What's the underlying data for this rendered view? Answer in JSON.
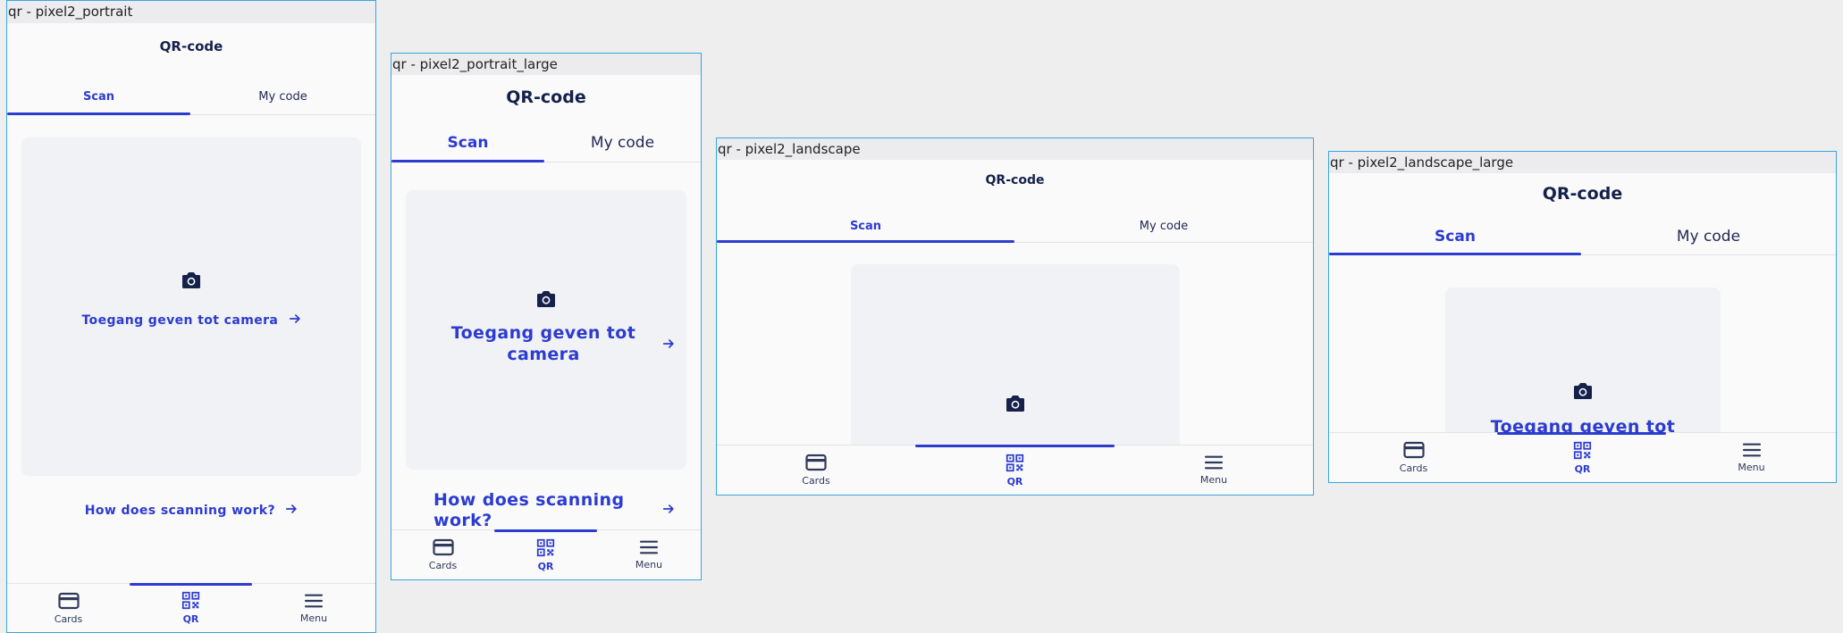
{
  "frames": [
    {
      "caption": "qr - pixel2_portrait",
      "title": "QR-code",
      "tabs": [
        "Scan",
        "My code"
      ],
      "camera_link": "Toegang geven tot camera",
      "howto_link": "How does scanning work?",
      "nav": [
        "Cards",
        "QR",
        "Menu"
      ]
    },
    {
      "caption": "qr - pixel2_portrait_large",
      "title": "QR-code",
      "tabs": [
        "Scan",
        "My code"
      ],
      "camera_link_line1": "Toegang geven tot",
      "camera_link_line2": "camera",
      "howto_line1": "How does scanning",
      "howto_line2": "work?",
      "nav": [
        "Cards",
        "QR",
        "Menu"
      ]
    },
    {
      "caption": "qr - pixel2_landscape",
      "title": "QR-code",
      "tabs": [
        "Scan",
        "My code"
      ],
      "nav": [
        "Cards",
        "QR",
        "Menu"
      ]
    },
    {
      "caption": "qr - pixel2_landscape_large",
      "title": "QR-code",
      "tabs": [
        "Scan",
        "My code"
      ],
      "camera_link_partial": "Toegang geven tot",
      "nav": [
        "Cards",
        "QR",
        "Menu"
      ]
    }
  ],
  "icons": {
    "camera": "camera-icon",
    "arrow": "arrow-right-icon",
    "cards": "card-icon",
    "qr": "qr-code-icon",
    "menu": "hamburger-menu-icon"
  },
  "colors": {
    "accent": "#2c3bd0",
    "title": "#15214a",
    "frame_border": "#38a6dc",
    "canvas": "#eeeeee",
    "camera_box": "#f1f2f5"
  }
}
